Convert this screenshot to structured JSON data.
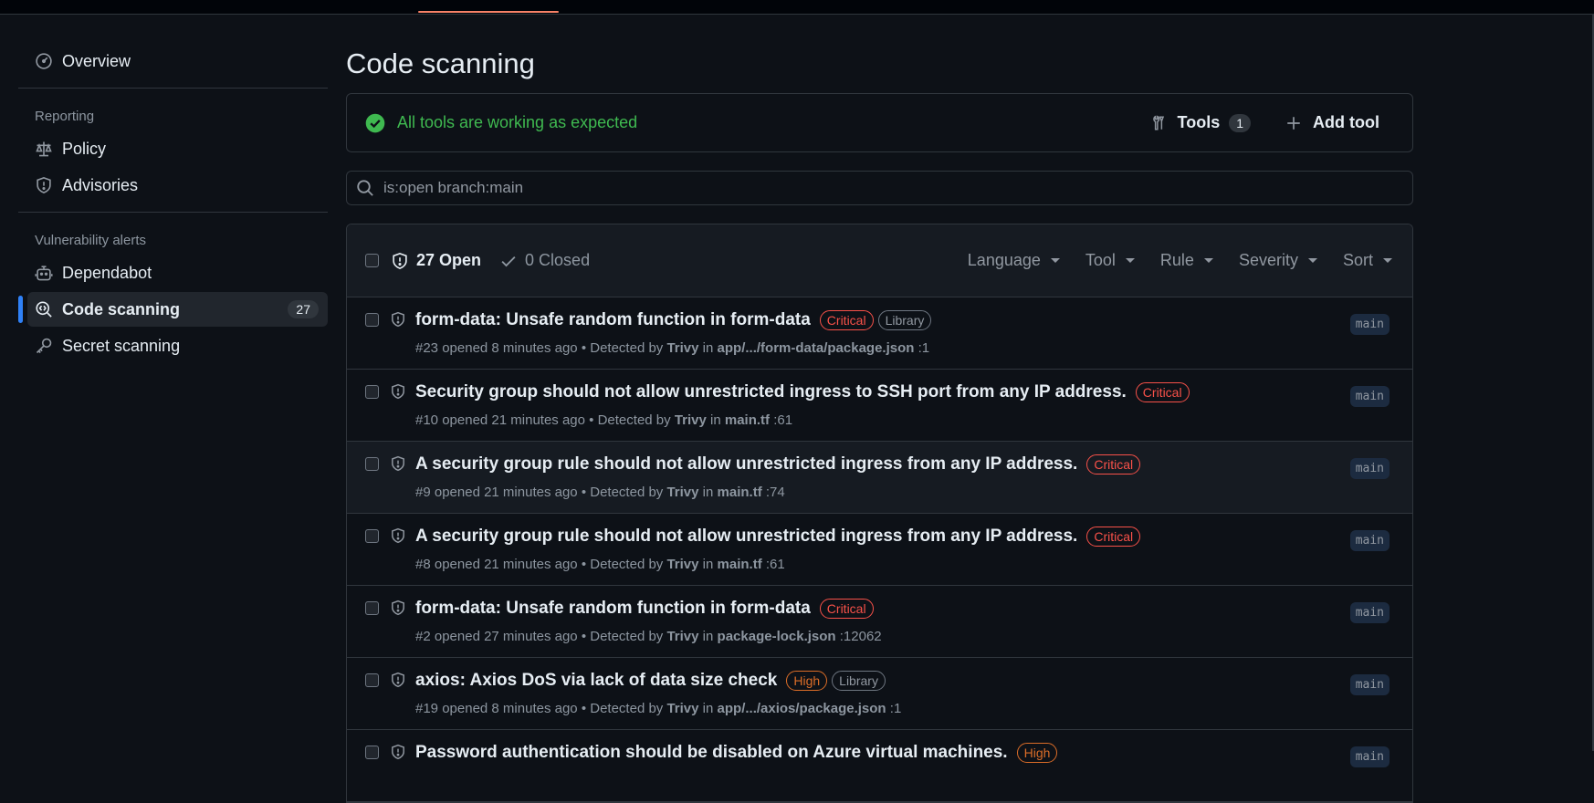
{
  "sidebar": {
    "overview": "Overview",
    "reporting_heading": "Reporting",
    "policy": "Policy",
    "advisories": "Advisories",
    "vulnerability_heading": "Vulnerability alerts",
    "dependabot": "Dependabot",
    "code_scanning": "Code scanning",
    "code_scanning_count": "27",
    "secret_scanning": "Secret scanning"
  },
  "main": {
    "title": "Code scanning",
    "status_text": "All tools are working as expected",
    "tools_label": "Tools",
    "tools_count": "1",
    "add_tool_label": "Add tool",
    "search_value": "is:open branch:main"
  },
  "alerts_header": {
    "open_label": "27 Open",
    "closed_label": "0 Closed",
    "filters": [
      "Language",
      "Tool",
      "Rule",
      "Severity",
      "Sort"
    ]
  },
  "alerts": [
    {
      "title": "form-data: Unsafe random function in form-data",
      "severity": "Critical",
      "tag": "Library",
      "number": "#23",
      "opened": "opened 8 minutes ago",
      "detected_by": "• Detected by",
      "tool": "Trivy",
      "in": "in",
      "path": "app/.../form-data/package.json",
      "line": ":1",
      "branch": "main"
    },
    {
      "title": "Security group should not allow unrestricted ingress to SSH port from any IP address.",
      "severity": "Critical",
      "tag": "",
      "number": "#10",
      "opened": "opened 21 minutes ago",
      "detected_by": "• Detected by",
      "tool": "Trivy",
      "in": "in",
      "path": "main.tf",
      "line": ":61",
      "branch": "main"
    },
    {
      "title": "A security group rule should not allow unrestricted ingress from any IP address.",
      "severity": "Critical",
      "tag": "",
      "number": "#9",
      "opened": "opened 21 minutes ago",
      "detected_by": "• Detected by",
      "tool": "Trivy",
      "in": "in",
      "path": "main.tf",
      "line": ":74",
      "branch": "main"
    },
    {
      "title": "A security group rule should not allow unrestricted ingress from any IP address.",
      "severity": "Critical",
      "tag": "",
      "number": "#8",
      "opened": "opened 21 minutes ago",
      "detected_by": "• Detected by",
      "tool": "Trivy",
      "in": "in",
      "path": "main.tf",
      "line": ":61",
      "branch": "main"
    },
    {
      "title": "form-data: Unsafe random function in form-data",
      "severity": "Critical",
      "tag": "",
      "number": "#2",
      "opened": "opened 27 minutes ago",
      "detected_by": "• Detected by",
      "tool": "Trivy",
      "in": "in",
      "path": "package-lock.json",
      "line": ":12062",
      "branch": "main"
    },
    {
      "title": "axios: Axios DoS via lack of data size check",
      "severity": "High",
      "tag": "Library",
      "number": "#19",
      "opened": "opened 8 minutes ago",
      "detected_by": "• Detected by",
      "tool": "Trivy",
      "in": "in",
      "path": "app/.../axios/package.json",
      "line": ":1",
      "branch": "main"
    },
    {
      "title": "Password authentication should be disabled on Azure virtual machines.",
      "severity": "High",
      "tag": "",
      "number": "",
      "opened": "",
      "detected_by": "",
      "tool": "",
      "in": "",
      "path": "",
      "line": "",
      "branch": "main"
    }
  ],
  "colors": {
    "background": "#0d1117",
    "accent_blue": "#2f81f7",
    "success_green": "#3fb950",
    "critical_red": "#f85149",
    "high_orange": "#db6d28",
    "tab_underline": "#f78166"
  },
  "icons": {
    "overview": "meter-icon",
    "policy": "law-scale-icon",
    "advisories": "shield-icon",
    "dependabot": "robot-icon",
    "code_scanning": "codescan-icon",
    "secret_scanning": "key-icon",
    "status": "check-circle-icon",
    "tools": "tools-icon",
    "add": "plus-icon",
    "search": "search-icon",
    "alert": "shield-icon"
  }
}
